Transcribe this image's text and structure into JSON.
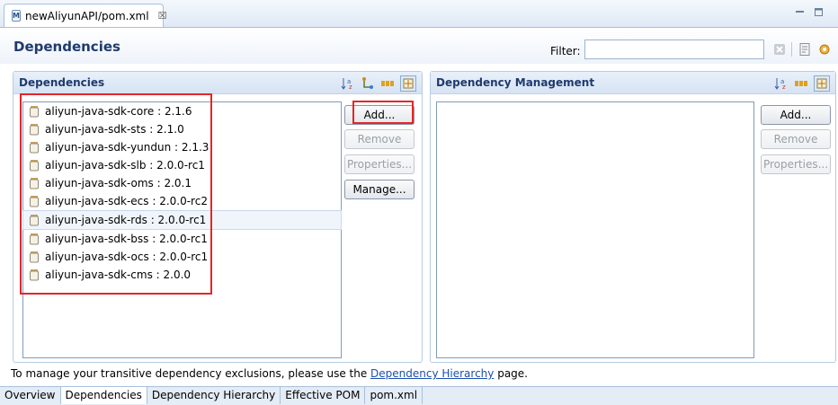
{
  "editor": {
    "tab_label": "newAliyunAPI/pom.xml",
    "tab_close": "☒",
    "file_icon_letter": "M"
  },
  "header": {
    "title": "Dependencies",
    "filter_label": "Filter:",
    "filter_value": ""
  },
  "dependencies": {
    "title": "Dependencies",
    "items": [
      "aliyun-java-sdk-core : 2.1.6",
      "aliyun-java-sdk-sts : 2.1.0",
      "aliyun-java-sdk-yundun : 2.1.3",
      "aliyun-java-sdk-slb : 2.0.0-rc1",
      "aliyun-java-sdk-oms : 2.0.1",
      "aliyun-java-sdk-ecs : 2.0.0-rc2",
      "aliyun-java-sdk-rds : 2.0.0-rc1",
      "aliyun-java-sdk-bss : 2.0.0-rc1",
      "aliyun-java-sdk-ocs : 2.0.0-rc1",
      "aliyun-java-sdk-cms : 2.0.0"
    ],
    "selected_index": 6,
    "buttons": {
      "add": "Add...",
      "remove": "Remove",
      "properties": "Properties...",
      "manage": "Manage..."
    }
  },
  "dependency_management": {
    "title": "Dependency Management",
    "buttons": {
      "add": "Add...",
      "remove": "Remove",
      "properties": "Properties..."
    }
  },
  "footer": {
    "text_before": "To manage your transitive dependency exclusions, please use the ",
    "link": "Dependency Hierarchy",
    "text_after": " page."
  },
  "bottom_tabs": [
    "Overview",
    "Dependencies",
    "Dependency Hierarchy",
    "Effective POM",
    "pom.xml"
  ],
  "active_bottom_tab": 1,
  "colors": {
    "highlight": "#e5252a",
    "title": "#1f3a6e",
    "link": "#1a4fb0"
  }
}
